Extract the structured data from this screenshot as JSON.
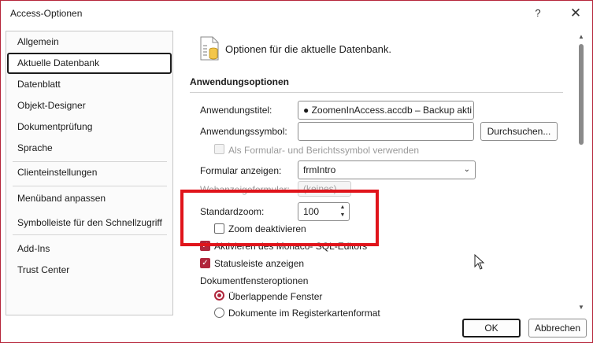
{
  "window": {
    "title": "Access-Optionen",
    "help_icon": "?",
    "close_icon": "✕"
  },
  "sidebar": {
    "items": [
      {
        "label": "Allgemein"
      },
      {
        "label": "Aktuelle Datenbank",
        "selected": true
      },
      {
        "label": "Datenblatt"
      },
      {
        "label": "Objekt-Designer"
      },
      {
        "label": "Dokumentprüfung"
      },
      {
        "label": "Sprache"
      },
      {
        "label": "Clienteinstellungen"
      },
      {
        "label": "Menüband anpassen"
      },
      {
        "label": "Symbolleiste für den Schnellzugriff"
      },
      {
        "label": "Add-Ins"
      },
      {
        "label": "Trust Center"
      }
    ]
  },
  "header": {
    "icon": "database-options-icon",
    "text": "Optionen für die aktuelle Datenbank."
  },
  "section": {
    "title": "Anwendungsoptionen"
  },
  "form": {
    "app_title_label": "Anwendungstitel:",
    "app_title_value": "● ZoomenInAccess.accdb – Backup akti",
    "app_icon_label": "Anwendungssymbol:",
    "app_icon_value": "",
    "browse_button": "Durchsuchen...",
    "use_as_form_icon_label": "Als Formular- und Berichtssymbol verwenden",
    "show_form_label": "Formular anzeigen:",
    "show_form_value": "frmIntro",
    "web_form_label": "Webanzeigeformular:",
    "web_form_value": "(keines)",
    "default_zoom_label": "Standardzoom:",
    "default_zoom_value": "100",
    "disable_zoom_label": "Zoom deaktivieren",
    "monaco_label": "Aktivieren des Monaco- SQL-Editors",
    "statusbar_label": "Statusleiste anzeigen",
    "doc_window_options_label": "Dokumentfensteroptionen",
    "overlapping_label": "Überlappende Fenster",
    "tabbed_label": "Dokumente im Registerkartenformat"
  },
  "footer": {
    "ok_button": "OK",
    "cancel_button": "Abbrechen"
  },
  "colors": {
    "accent": "#b0263c",
    "highlight_frame": "#e0141b"
  }
}
